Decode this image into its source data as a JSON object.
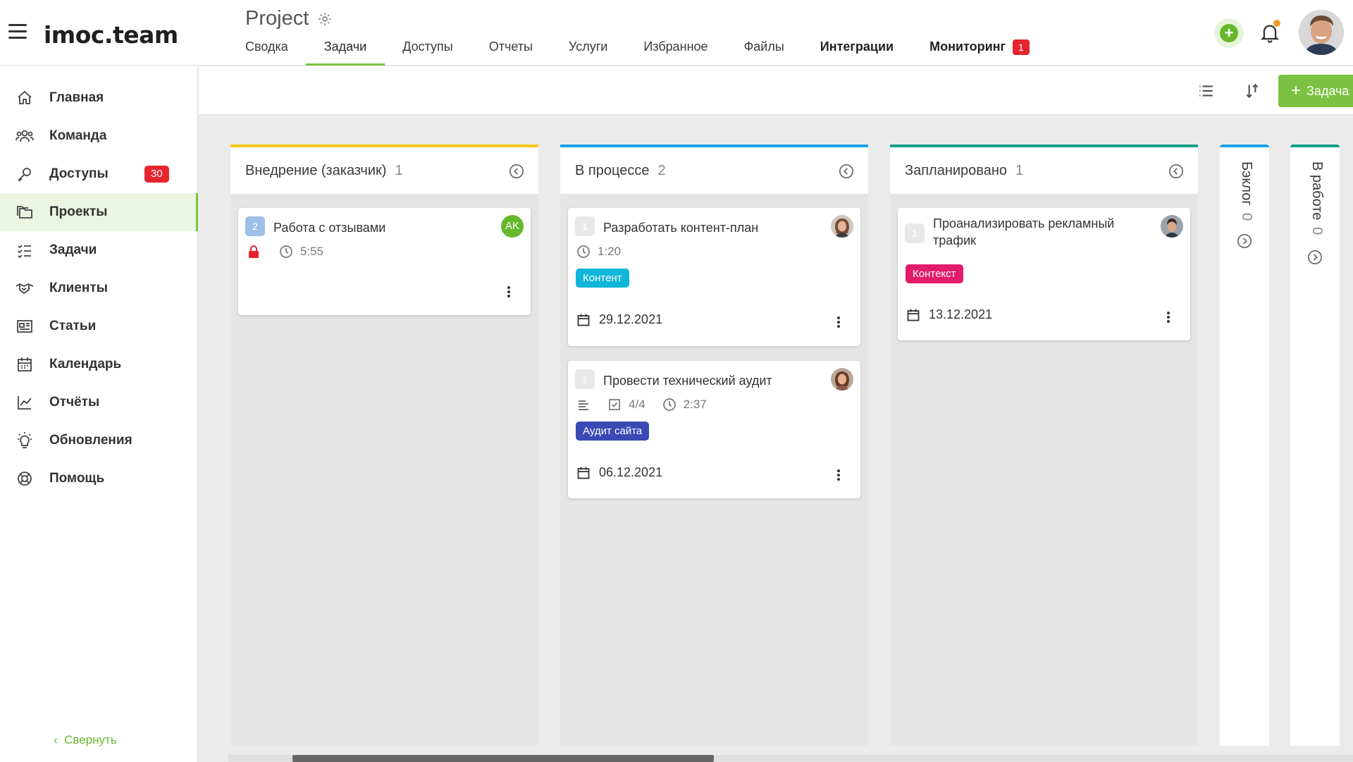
{
  "brand": {
    "logo_text": "imoc.team",
    "accent": "#7cc142",
    "danger": "#e5242e"
  },
  "header": {
    "project_title": "Project",
    "tabs": [
      {
        "label": "Сводка"
      },
      {
        "label": "Задачи",
        "active": true
      },
      {
        "label": "Доступы"
      },
      {
        "label": "Отчеты"
      },
      {
        "label": "Услуги"
      },
      {
        "label": "Избранное"
      },
      {
        "label": "Файлы"
      },
      {
        "label": "Интеграции"
      },
      {
        "label": "Мониторинг",
        "badge": "1"
      }
    ]
  },
  "sidebar": {
    "items": [
      {
        "label": "Главная",
        "icon": "home-icon"
      },
      {
        "label": "Команда",
        "icon": "team-icon"
      },
      {
        "label": "Доступы",
        "icon": "key-icon",
        "badge": "30"
      },
      {
        "label": "Проекты",
        "icon": "folders-icon",
        "active": true
      },
      {
        "label": "Задачи",
        "icon": "tasks-icon"
      },
      {
        "label": "Клиенты",
        "icon": "handshake-icon"
      },
      {
        "label": "Статьи",
        "icon": "articles-icon"
      },
      {
        "label": "Календарь",
        "icon": "calendar-icon"
      },
      {
        "label": "Отчёты",
        "icon": "chart-icon"
      },
      {
        "label": "Обновления",
        "icon": "bulb-icon"
      },
      {
        "label": "Помощь",
        "icon": "lifebuoy-icon"
      }
    ],
    "collapse_label": "Свернуть"
  },
  "toolbar": {
    "add_task_label": "Задача"
  },
  "board": {
    "columns": [
      {
        "title": "Внедрение (заказчик)",
        "count": "1",
        "color": "#f5c518",
        "cards": [
          {
            "num": "2",
            "title": "Работа с отзывами",
            "avatar": "AK",
            "locked": true,
            "time": "5:55"
          }
        ]
      },
      {
        "title": "В процессе",
        "count": "2",
        "color": "#1aa3e8",
        "cards": [
          {
            "num": "1",
            "title": "Разработать контент-план",
            "time": "1:20",
            "tag": "Контент",
            "tag_color": "#10b6d8",
            "date": "29.12.2021"
          },
          {
            "num": "1",
            "title": "Провести технический аудит",
            "checklist": "4/4",
            "time": "2:37",
            "tag": "Аудит сайта",
            "tag_color": "#3a4ab5",
            "date": "06.12.2021"
          }
        ]
      },
      {
        "title": "Запланировано",
        "count": "1",
        "color": "#17a089",
        "cards": [
          {
            "num": "1",
            "title": "Проанализировать рекламный трафик",
            "tag": "Контекст",
            "tag_color": "#e21b6a",
            "date": "13.12.2021"
          }
        ]
      }
    ],
    "collapsed": [
      {
        "title": "Бэклог",
        "count": "0",
        "color": "#1aa3e8"
      },
      {
        "title": "В работе",
        "count": "0",
        "color": "#17a089"
      }
    ]
  }
}
